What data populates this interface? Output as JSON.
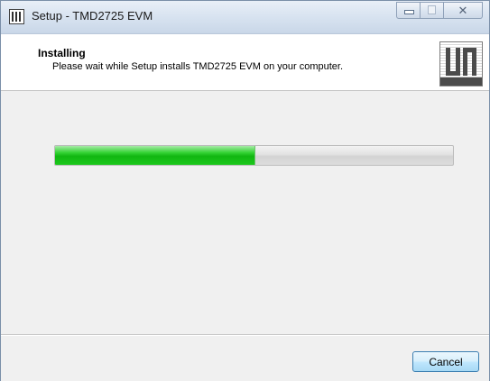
{
  "window": {
    "title": "Setup - TMD2725 EVM"
  },
  "header": {
    "title": "Installing",
    "subtitle": "Please wait while Setup installs TMD2725 EVM on your computer."
  },
  "progress": {
    "value": 0.5,
    "fill_color": "#1cc81c"
  },
  "footer": {
    "cancel_label": "Cancel"
  },
  "icons": {
    "app": "setup-app-icon",
    "logo": "installer-logo",
    "minimize": "minimize-icon",
    "maximize": "maximize-icon",
    "close": "close-icon"
  }
}
